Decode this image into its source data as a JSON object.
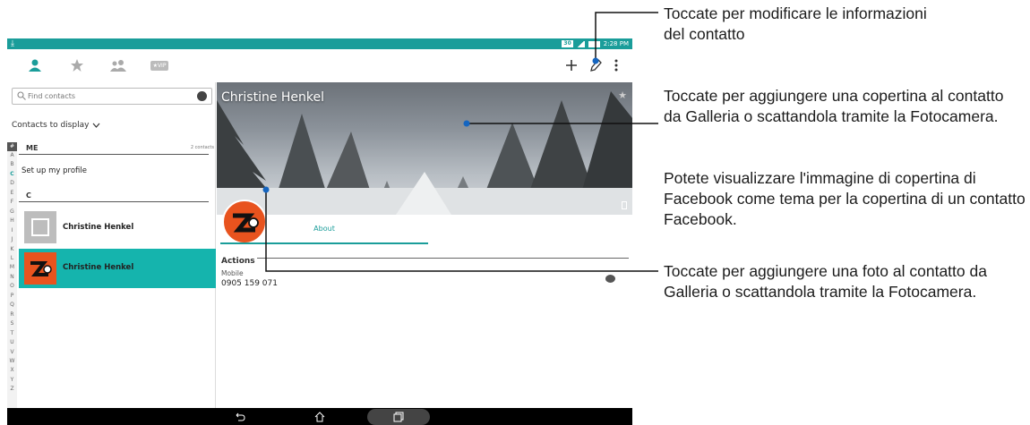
{
  "status_bar": {
    "time": "2:28 PM",
    "badge": "30"
  },
  "header": {
    "tabs": [
      {
        "icon": "person-icon",
        "active": true
      },
      {
        "icon": "star-icon",
        "active": false
      },
      {
        "icon": "group-icon",
        "active": false
      },
      {
        "icon": "vip-icon",
        "label": "★VIP",
        "active": false
      }
    ],
    "actions": [
      "add-icon",
      "edit-icon",
      "overflow-menu-icon"
    ]
  },
  "search": {
    "placeholder": "Find contacts"
  },
  "contacts_to_display": "Contacts to display",
  "index_letters": [
    "A",
    "B",
    "C",
    "D",
    "E",
    "F",
    "G",
    "H",
    "I",
    "J",
    "K",
    "L",
    "M",
    "N",
    "O",
    "P",
    "Q",
    "R",
    "S",
    "T",
    "U",
    "V",
    "W",
    "X",
    "Y",
    "Z"
  ],
  "index_hash": "#",
  "active_letter": "C",
  "me_section": {
    "label": "ME",
    "count": "2 contacts",
    "setup": "Set up my profile"
  },
  "c_section": {
    "label": "C"
  },
  "contacts": [
    {
      "name": "Christine Henkel",
      "selected": false
    },
    {
      "name": "Christine Henkel",
      "selected": true
    }
  ],
  "detail": {
    "name": "Christine Henkel",
    "tab": "About",
    "actions_label": "Actions",
    "phone_type": "Mobile",
    "phone_number": "0905 159 071"
  },
  "callouts": {
    "edit": "Toccate per modificare le informazioni del contatto",
    "cover": "Toccate per aggiungere una copertina al contatto da Galleria o scattandola tramite la Fotocamera.",
    "facebook": "Potete visualizzare l'immagine di copertina di Facebook come tema per la copertina di un contatto Facebook.",
    "photo": "Toccate per aggiungere una foto al contatto da Galleria o scattandola tramite la Fotocamera."
  },
  "colors": {
    "accent": "#1a9d9a",
    "selected_row": "#15b4ad",
    "avatar": "#e8531e"
  }
}
